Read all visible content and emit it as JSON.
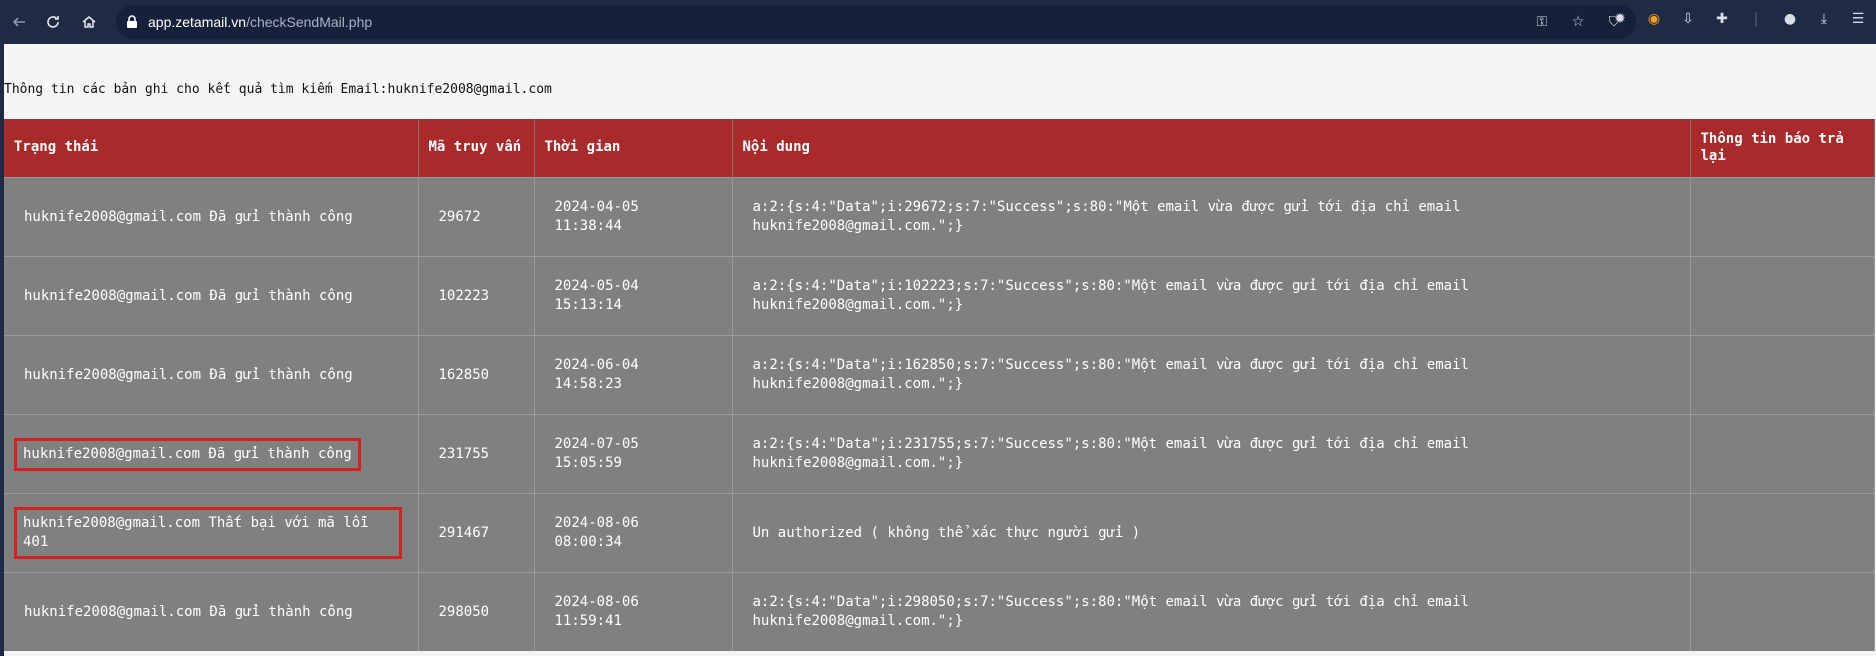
{
  "browser": {
    "url_host": "app.zetamail.vn",
    "url_path": "/checkSendMail.php",
    "icons": {
      "back": "back-icon",
      "reload": "reload-icon",
      "home": "home-icon",
      "lock": "lock-icon",
      "key": "key-icon",
      "star": "star-icon",
      "shield": "shield-icon",
      "extensions": [
        "bug-icon",
        "colorwheel-icon",
        "download-box-icon",
        "puzzle-icon"
      ],
      "profile": "profile-icon",
      "downloads": "download-icon",
      "menu": "menu-icon"
    }
  },
  "page": {
    "intro": "Thông tin các bản ghi cho kết quả tìm kiếm Email:huknife2008@gmail.com",
    "table": {
      "headers": {
        "status": "Trạng thái",
        "query_code": "Mã truy vấn",
        "time": "Thời gian",
        "content": "Nội dung",
        "feedback": "Thông tin báo trả lại"
      },
      "rows": [
        {
          "status": "huknife2008@gmail.com Đã gửi thành công",
          "code": "29672",
          "date": "2024-04-05",
          "clock": "11:38:44",
          "content": "a:2:{s:4:\"Data\";i:29672;s:7:\"Success\";s:80:\"Một email vừa được gửi tới địa chỉ email huknife2008@gmail.com.\";}",
          "feedback": ""
        },
        {
          "status": "huknife2008@gmail.com Đã gửi thành công",
          "code": "102223",
          "date": "2024-05-04",
          "clock": "15:13:14",
          "content": "a:2:{s:4:\"Data\";i:102223;s:7:\"Success\";s:80:\"Một email vừa được gửi tới địa chỉ email huknife2008@gmail.com.\";}",
          "feedback": ""
        },
        {
          "status": "huknife2008@gmail.com Đã gửi thành công",
          "code": "162850",
          "date": "2024-06-04",
          "clock": "14:58:23",
          "content": "a:2:{s:4:\"Data\";i:162850;s:7:\"Success\";s:80:\"Một email vừa được gửi tới địa chỉ email huknife2008@gmail.com.\";}",
          "feedback": ""
        },
        {
          "status": "huknife2008@gmail.com Đã gửi thành công",
          "code": "231755",
          "date": "2024-07-05",
          "clock": "15:05:59",
          "content": "a:2:{s:4:\"Data\";i:231755;s:7:\"Success\";s:80:\"Một email vừa được gửi tới địa chỉ email huknife2008@gmail.com.\";}",
          "feedback": "",
          "highlighted": true
        },
        {
          "status": "huknife2008@gmail.com Thất bại với mã lỗi 401",
          "code": "291467",
          "date": "2024-08-06",
          "clock": "08:00:34",
          "content": "Un authorized ( không thể xác thực người gửi )",
          "feedback": "",
          "highlighted": true
        },
        {
          "status": "huknife2008@gmail.com Đã gửi thành công",
          "code": "298050",
          "date": "2024-08-06",
          "clock": "11:59:41",
          "content": "a:2:{s:4:\"Data\";i:298050;s:7:\"Success\";s:80:\"Một email vừa được gửi tới địa chỉ email huknife2008@gmail.com.\";}",
          "feedback": ""
        }
      ]
    }
  },
  "colors": {
    "header_bg": "#a82a2a",
    "cell_bg": "#808080",
    "highlight_border": "#d32020",
    "toolbar_bg": "#1f2a44"
  }
}
